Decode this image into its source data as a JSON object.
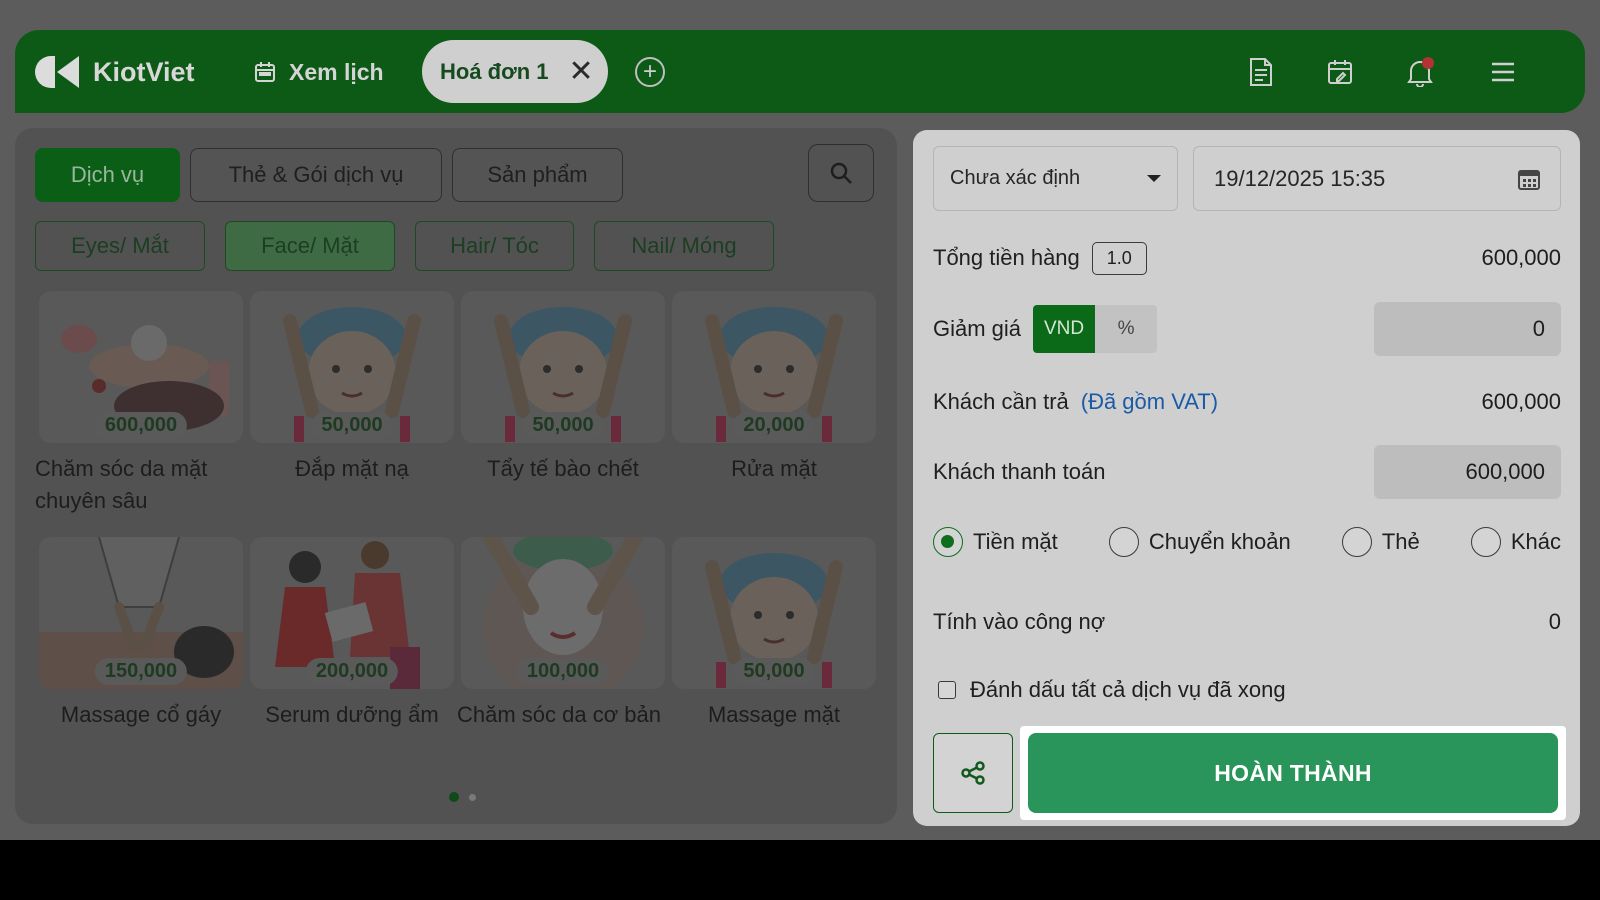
{
  "header": {
    "brand": "KiotViet",
    "calendar_link": "Xem lịch",
    "active_tab": "Hoá đơn 1",
    "add_tab_symbol": "+"
  },
  "left": {
    "tabs": [
      {
        "label": "Dịch vụ",
        "active": true
      },
      {
        "label": "Thẻ & Gói dịch vụ",
        "active": false
      },
      {
        "label": "Sản phẩm",
        "active": false
      }
    ],
    "categories": [
      {
        "label": "Eyes/ Mắt",
        "active": false
      },
      {
        "label": "Face/ Mặt",
        "active": true
      },
      {
        "label": "Hair/ Tóc",
        "active": false
      },
      {
        "label": "Nail/ Móng",
        "active": false
      }
    ],
    "services": [
      {
        "price": "600,000",
        "name": "Chăm sóc da mặt chuyên sâu"
      },
      {
        "price": "50,000",
        "name": "Đắp mặt nạ"
      },
      {
        "price": "50,000",
        "name": "Tẩy tế bào chết"
      },
      {
        "price": "20,000",
        "name": "Rửa mặt"
      },
      {
        "price": "150,000",
        "name": "Massage cổ gáy"
      },
      {
        "price": "200,000",
        "name": "Serum dưỡng ẩm"
      },
      {
        "price": "100,000",
        "name": "Chăm sóc da cơ bản"
      },
      {
        "price": "50,000",
        "name": "Massage mặt"
      }
    ]
  },
  "checkout": {
    "customer_select": "Chưa xác định",
    "datetime": "19/12/2025 15:35",
    "total_label": "Tổng tiền hàng",
    "total_qty": "1.0",
    "total_value": "600,000",
    "discount_label": "Giảm giá",
    "discount_vnd": "VND",
    "discount_pct": "%",
    "discount_value": "0",
    "pay_label": "Khách cần trả",
    "pay_vat": "(Đã gồm VAT)",
    "pay_value": "600,000",
    "paid_label": "Khách thanh toán",
    "paid_value": "600,000",
    "methods": [
      {
        "label": "Tiền mặt",
        "checked": true
      },
      {
        "label": "Chuyển khoản",
        "checked": false
      },
      {
        "label": "Thẻ",
        "checked": false
      },
      {
        "label": "Khác",
        "checked": false
      }
    ],
    "debt_label": "Tính vào công nợ",
    "debt_value": "0",
    "mark_all_label": "Đánh dấu tất cả dịch vụ đã xong",
    "done_label": "HOÀN THÀNH"
  },
  "colors": {
    "brand_green": "#0c5a16",
    "done_button": "#2a955a",
    "vat_blue": "#1a5aa6"
  }
}
